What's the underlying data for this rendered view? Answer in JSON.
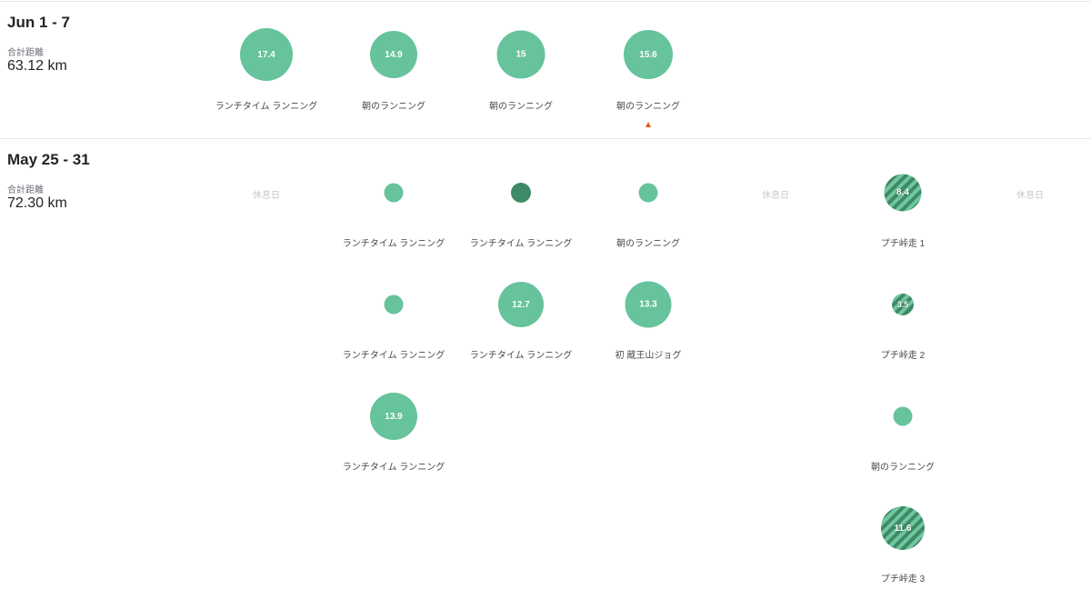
{
  "weeks": [
    {
      "title": "Jun 1 - 7",
      "total_label": "合計距離",
      "total_value": "63.12 km",
      "activities": [
        {
          "distance": "17.4",
          "name": "ランチタイム ランニング",
          "style": "normal"
        },
        {
          "distance": "14.9",
          "name": "朝のランニング",
          "style": "normal"
        },
        {
          "distance": "15",
          "name": "朝のランニング",
          "style": "normal"
        },
        {
          "distance": "15.6",
          "name": "朝のランニング",
          "style": "normal"
        }
      ]
    },
    {
      "title": "May 25 - 31",
      "total_label": "合計距離",
      "total_value": "72.30 km",
      "rest_label": "休息日",
      "activities": [
        {
          "distance": "",
          "name": "ランチタイム ランニング",
          "style": "normal"
        },
        {
          "distance": "",
          "name": "ランチタイム ランニング",
          "style": "dark"
        },
        {
          "distance": "",
          "name": "朝のランニング",
          "style": "normal"
        },
        {
          "distance": "8.4",
          "name": "プチ峠走 1",
          "style": "striped"
        },
        {
          "distance": "",
          "name": "ランチタイム ランニング",
          "style": "normal"
        },
        {
          "distance": "12.7",
          "name": "ランチタイム ランニング",
          "style": "normal"
        },
        {
          "distance": "13.3",
          "name": "初 蔵王山ジョグ",
          "style": "normal"
        },
        {
          "distance": "3.5",
          "name": "プチ峠走 2",
          "style": "striped"
        },
        {
          "distance": "13.9",
          "name": "ランチタイム ランニング",
          "style": "normal"
        },
        {
          "distance": "",
          "name": "朝のランニング",
          "style": "normal"
        },
        {
          "distance": "11.6",
          "name": "プチ峠走 3",
          "style": "striped"
        }
      ]
    }
  ],
  "colors": {
    "run": "#66c39b",
    "run_selected": "#3f8a66",
    "marker": "#e35c1b"
  }
}
